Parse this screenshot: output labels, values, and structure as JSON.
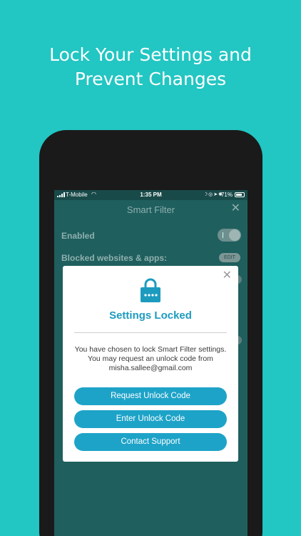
{
  "headline": {
    "line1": "Lock Your Settings and",
    "line2": "Prevent Changes"
  },
  "status_bar": {
    "carrier": "T-Mobile",
    "time": "1:35 PM",
    "battery": "71%"
  },
  "app": {
    "title": "Smart Filter",
    "rows": {
      "enabled_label": "Enabled",
      "blocked_label": "Blocked websites & apps:",
      "edit_label": "EDIT"
    }
  },
  "modal": {
    "title": "Settings Locked",
    "message": "You have chosen to lock Smart Filter settings. You may request an unlock code from misha.sallee@gmail.com",
    "buttons": {
      "request": "Request Unlock Code",
      "enter": "Enter Unlock Code",
      "support": "Contact Support"
    }
  },
  "colors": {
    "background": "#22c6c2",
    "accent": "#1ea3c8"
  },
  "icons": [
    "lock-icon",
    "close-icon",
    "wifi-icon",
    "battery-icon",
    "signal-icon"
  ]
}
